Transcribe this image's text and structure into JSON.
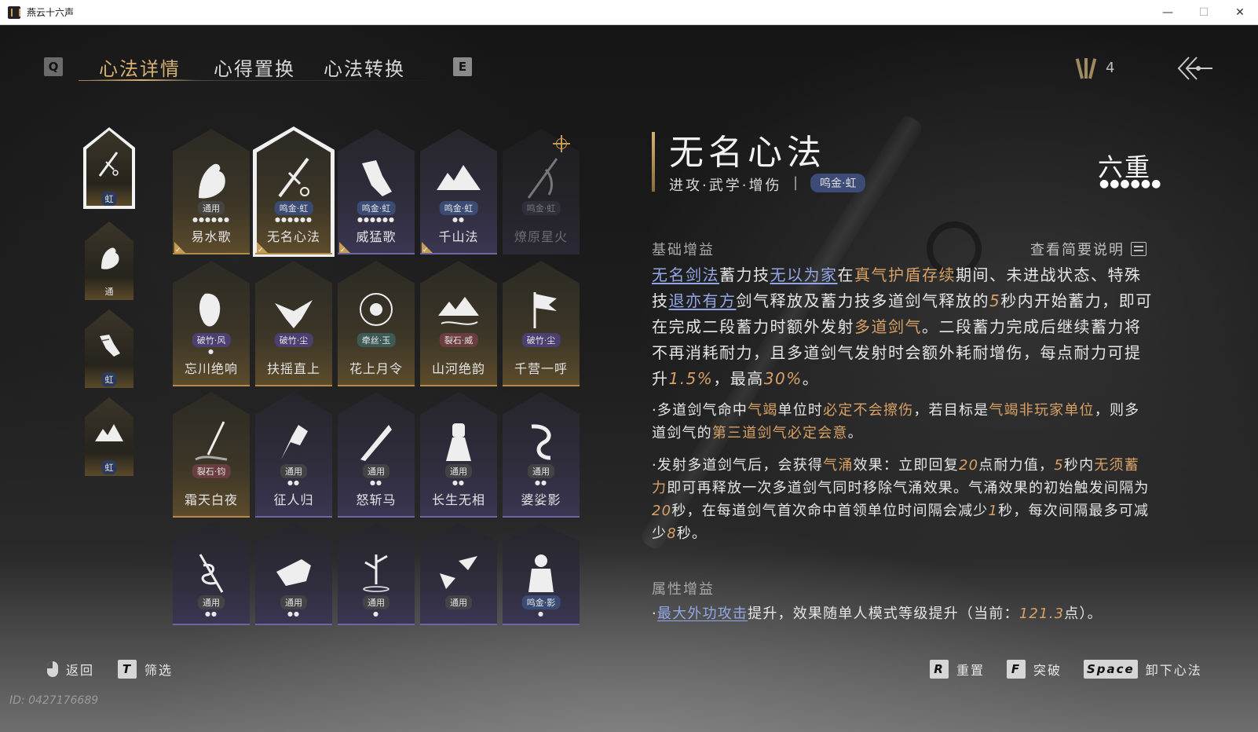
{
  "window": {
    "title": "燕云十六声",
    "minimize": "—",
    "maximize": "☐",
    "close": "✕"
  },
  "tabs": {
    "key_left": "Q",
    "key_right": "E",
    "items": [
      {
        "label": "心法详情",
        "active": true
      },
      {
        "label": "心得置换",
        "active": false
      },
      {
        "label": "心法转换",
        "active": false
      }
    ]
  },
  "currency": {
    "icon": "arrow-bundle-icon",
    "value": "4"
  },
  "back_icon": "back-arrow-icon",
  "equipped": [
    {
      "icon": "sword-icon",
      "badge": "虹"
    },
    {
      "icon": "horse-icon",
      "badge": "通"
    },
    {
      "icon": "fist-icon",
      "badge": "虹"
    },
    {
      "icon": "mountain-icon",
      "badge": "虹"
    }
  ],
  "cards": [
    {
      "name": "易水歌",
      "tag": "通用",
      "tag_style": "t-general",
      "dots": "●●●●●●",
      "style": "gold",
      "check": true,
      "icon": "horse-icon"
    },
    {
      "name": "无名心法",
      "tag": "鸣金·虹",
      "tag_style": "t-blue",
      "dots": "●●●●●●",
      "style": "gold",
      "check": true,
      "selected": true,
      "icon": "sword-icon"
    },
    {
      "name": "威猛歌",
      "tag": "鸣金·虹",
      "tag_style": "t-blue",
      "dots": "●●●●●●",
      "style": "purple",
      "check": true,
      "icon": "fist-icon"
    },
    {
      "name": "千山法",
      "tag": "鸣金·虹",
      "tag_style": "t-blue",
      "dots": "●●",
      "style": "purple",
      "check": true,
      "icon": "mountain-icon"
    },
    {
      "name": "燎原星火",
      "tag": "鸣金·虹",
      "tag_style": "t-dim",
      "dots": "",
      "style": "locked",
      "target": true,
      "icon": "spear-icon"
    },
    {
      "name": "忘川绝响",
      "tag": "破竹·风",
      "tag_style": "t-purple",
      "dots": "●",
      "style": "gold",
      "icon": "mask-icon"
    },
    {
      "name": "扶摇直上",
      "tag": "破竹·尘",
      "tag_style": "t-purple",
      "dots": "",
      "style": "gold",
      "icon": "eagle-icon"
    },
    {
      "name": "花上月令",
      "tag": "牵丝·玉",
      "tag_style": "t-green",
      "dots": "",
      "style": "gold",
      "icon": "flower-icon"
    },
    {
      "name": "山河绝韵",
      "tag": "裂石·威",
      "tag_style": "t-red",
      "dots": "",
      "style": "gold",
      "icon": "landscape-icon"
    },
    {
      "name": "千营一呼",
      "tag": "破竹·尘",
      "tag_style": "t-purple",
      "dots": "",
      "style": "gold",
      "icon": "flag-icon"
    },
    {
      "name": "霜天白夜",
      "tag": "裂石·钧",
      "tag_style": "t-red",
      "dots": "",
      "style": "gold",
      "icon": "blade-icon"
    },
    {
      "name": "征人归",
      "tag": "通用",
      "tag_style": "t-general",
      "dots": "●●",
      "style": "purple",
      "icon": "bird-hand-icon"
    },
    {
      "name": "怒斩马",
      "tag": "通用",
      "tag_style": "t-general",
      "dots": "●●",
      "style": "purple",
      "icon": "saber-icon"
    },
    {
      "name": "长生无相",
      "tag": "通用",
      "tag_style": "t-general",
      "dots": "●●",
      "style": "purple",
      "icon": "statue-icon"
    },
    {
      "name": "婆娑影",
      "tag": "通用",
      "tag_style": "t-general",
      "dots": "●●",
      "style": "purple",
      "icon": "dragon-icon"
    },
    {
      "name": "",
      "tag": "通用",
      "tag_style": "t-general",
      "dots": "●●",
      "style": "purple",
      "icon": "snake-staff-icon"
    },
    {
      "name": "",
      "tag": "通用",
      "tag_style": "t-general",
      "dots": "●●",
      "style": "purple",
      "icon": "horse-head-icon"
    },
    {
      "name": "",
      "tag": "通用",
      "tag_style": "t-general",
      "dots": "●",
      "style": "purple",
      "icon": "bamboo-icon"
    },
    {
      "name": "",
      "tag": "通用",
      "tag_style": "t-general",
      "dots": "",
      "style": "purple",
      "icon": "swallows-icon"
    },
    {
      "name": "",
      "tag": "鸣金·影",
      "tag_style": "t-blue",
      "dots": "●",
      "style": "purple",
      "icon": "armor-icon"
    }
  ],
  "detail": {
    "title": "无名心法",
    "subtitle": "进攻·武学·增伤",
    "separator": "|",
    "tag": "鸣金·虹",
    "rank": "六重",
    "rank_dots": "●●●●●●",
    "basic_header": "基础增益",
    "view_desc": "查看简要说明",
    "para_main": [
      {
        "t": "无名剑法",
        "c": "lnk"
      },
      {
        "t": "蓄力技"
      },
      {
        "t": "无以为家",
        "c": "lnk"
      },
      {
        "t": "在"
      },
      {
        "t": "真气护盾存续",
        "c": "org"
      },
      {
        "t": "期间、未进战状态、特殊技"
      },
      {
        "t": "退亦有方",
        "c": "lnk"
      },
      {
        "t": "剑气释放及蓄力技多道剑气释放的"
      },
      {
        "t": "5",
        "c": "num"
      },
      {
        "t": "秒内开始蓄力，即可在完成二段蓄力时额外发射"
      },
      {
        "t": "多道剑气",
        "c": "org"
      },
      {
        "t": "。二段蓄力完成后继续蓄力将不再消耗耐力，且多道剑气发射时会额外耗耐增伤，每点耐力可提升"
      },
      {
        "t": "1.5%",
        "c": "num"
      },
      {
        "t": "，最高"
      },
      {
        "t": "30%",
        "c": "num"
      },
      {
        "t": "。"
      }
    ],
    "para_b1": [
      {
        "t": "·多道剑气命中"
      },
      {
        "t": "气竭",
        "c": "org"
      },
      {
        "t": "单位时"
      },
      {
        "t": "必定不会擦伤",
        "c": "org"
      },
      {
        "t": "，若目标是"
      },
      {
        "t": "气竭非玩家单位",
        "c": "org"
      },
      {
        "t": "，则多道剑气的"
      },
      {
        "t": "第三道剑气必定会意",
        "c": "org"
      },
      {
        "t": "。"
      }
    ],
    "para_b2": [
      {
        "t": "·发射多道剑气后，会获得"
      },
      {
        "t": "气涌",
        "c": "org"
      },
      {
        "t": "效果：立即回复"
      },
      {
        "t": "20",
        "c": "num"
      },
      {
        "t": "点耐力值，"
      },
      {
        "t": "5",
        "c": "num"
      },
      {
        "t": "秒内"
      },
      {
        "t": "无须蓄力",
        "c": "org"
      },
      {
        "t": "即可再释放一次多道剑气同时移除气涌效果。气涌效果的初始触发间隔为"
      },
      {
        "t": "20",
        "c": "num"
      },
      {
        "t": "秒，在每道剑气首次命中首领单位时间隔会减少"
      },
      {
        "t": "1",
        "c": "num"
      },
      {
        "t": "秒，每次间隔最多可减少"
      },
      {
        "t": "8",
        "c": "num"
      },
      {
        "t": "秒。"
      }
    ],
    "attr_header": "属性增益",
    "para_attr": [
      {
        "t": "·"
      },
      {
        "t": "最大外功攻击",
        "c": "lnk"
      },
      {
        "t": "提升，效果随单人模式等级提升（当前："
      },
      {
        "t": "121.3",
        "c": "num"
      },
      {
        "t": "点）。"
      }
    ]
  },
  "bottom": {
    "back_label": "返回",
    "filter_key": "T",
    "filter_label": "筛选",
    "reset_key": "R",
    "reset_label": "重置",
    "break_key": "F",
    "break_label": "突破",
    "unequip_key": "Space",
    "unequip_label": "卸下心法"
  },
  "uid": "ID: 0427176689"
}
